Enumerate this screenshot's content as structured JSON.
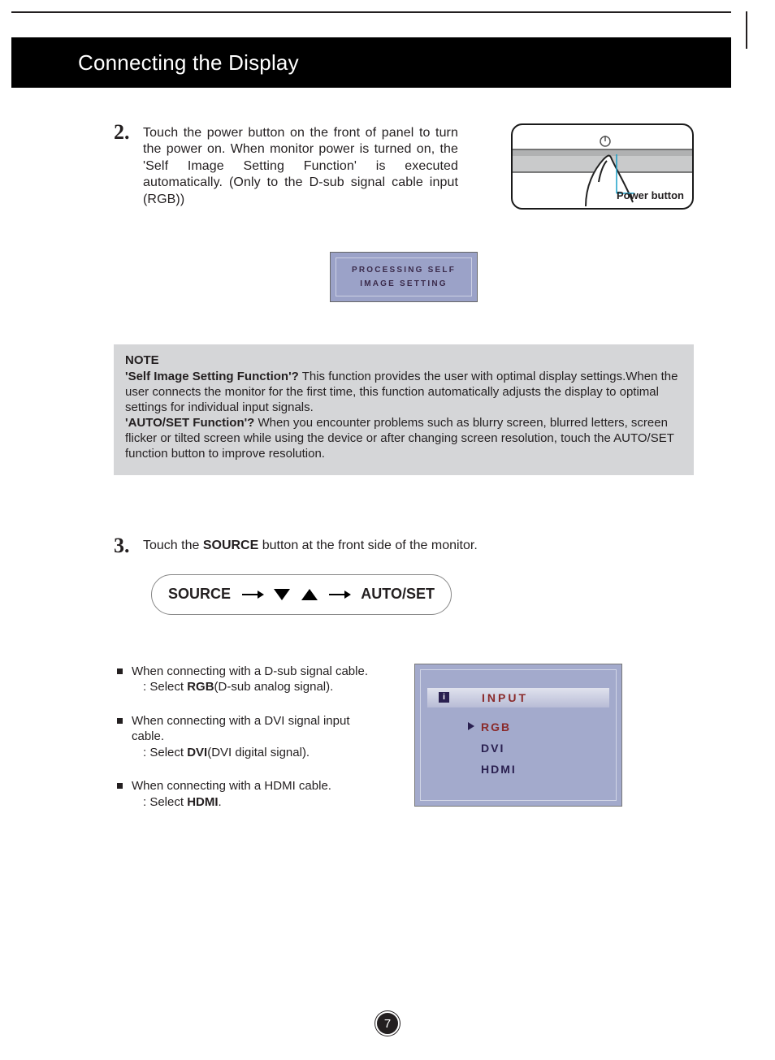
{
  "header": {
    "title": "Connecting the Display"
  },
  "step2": {
    "num": "2",
    "text": "Touch the power button on the front of panel to turn the power on. When monitor power is turned on, the 'Self Image Setting Function' is executed automatically. (Only to the D-sub signal cable input (RGB))",
    "power_label": "Power button"
  },
  "osd1": {
    "line1": "PROCESSING SELF",
    "line2": "IMAGE SETTING"
  },
  "note": {
    "heading": "NOTE",
    "b1_label": "'Self Image Setting Function'?",
    "b1_text": " This function provides the user with optimal display settings.When the user connects the monitor for the first time, this function automatically adjusts the display to optimal settings for individual input signals.",
    "b2_label": "'AUTO/SET Function'?",
    "b2_text": " When you encounter problems such as blurry screen, blurred letters, screen flicker or tilted screen while using the device or after changing screen resolution, touch the AUTO/SET function button to improve resolution."
  },
  "step3": {
    "num": "3",
    "pre": "Touch the ",
    "bold": "SOURCE",
    "post": " button at the front side of the monitor."
  },
  "source_fig": {
    "left": "SOURCE",
    "right": "AUTO/SET"
  },
  "bullets": {
    "b1": {
      "line": "When connecting with a D-sub signal cable.",
      "colon": ": ",
      "pre": "Select ",
      "bold": "RGB",
      "post": "(D-sub analog signal)."
    },
    "b2": {
      "line": "When connecting with a DVI signal input cable.",
      "colon": ": ",
      "pre": "Select ",
      "bold": "DVI",
      "post": "(DVI digital signal)."
    },
    "b3": {
      "line": "When connecting with a HDMI cable.",
      "colon": ": Select ",
      "bold": "HDMI",
      "post": "."
    }
  },
  "input_osd": {
    "icon": "i",
    "title": "INPUT",
    "opt1": "RGB",
    "opt2": "DVI",
    "opt3": "HDMI"
  },
  "page_number": "7"
}
